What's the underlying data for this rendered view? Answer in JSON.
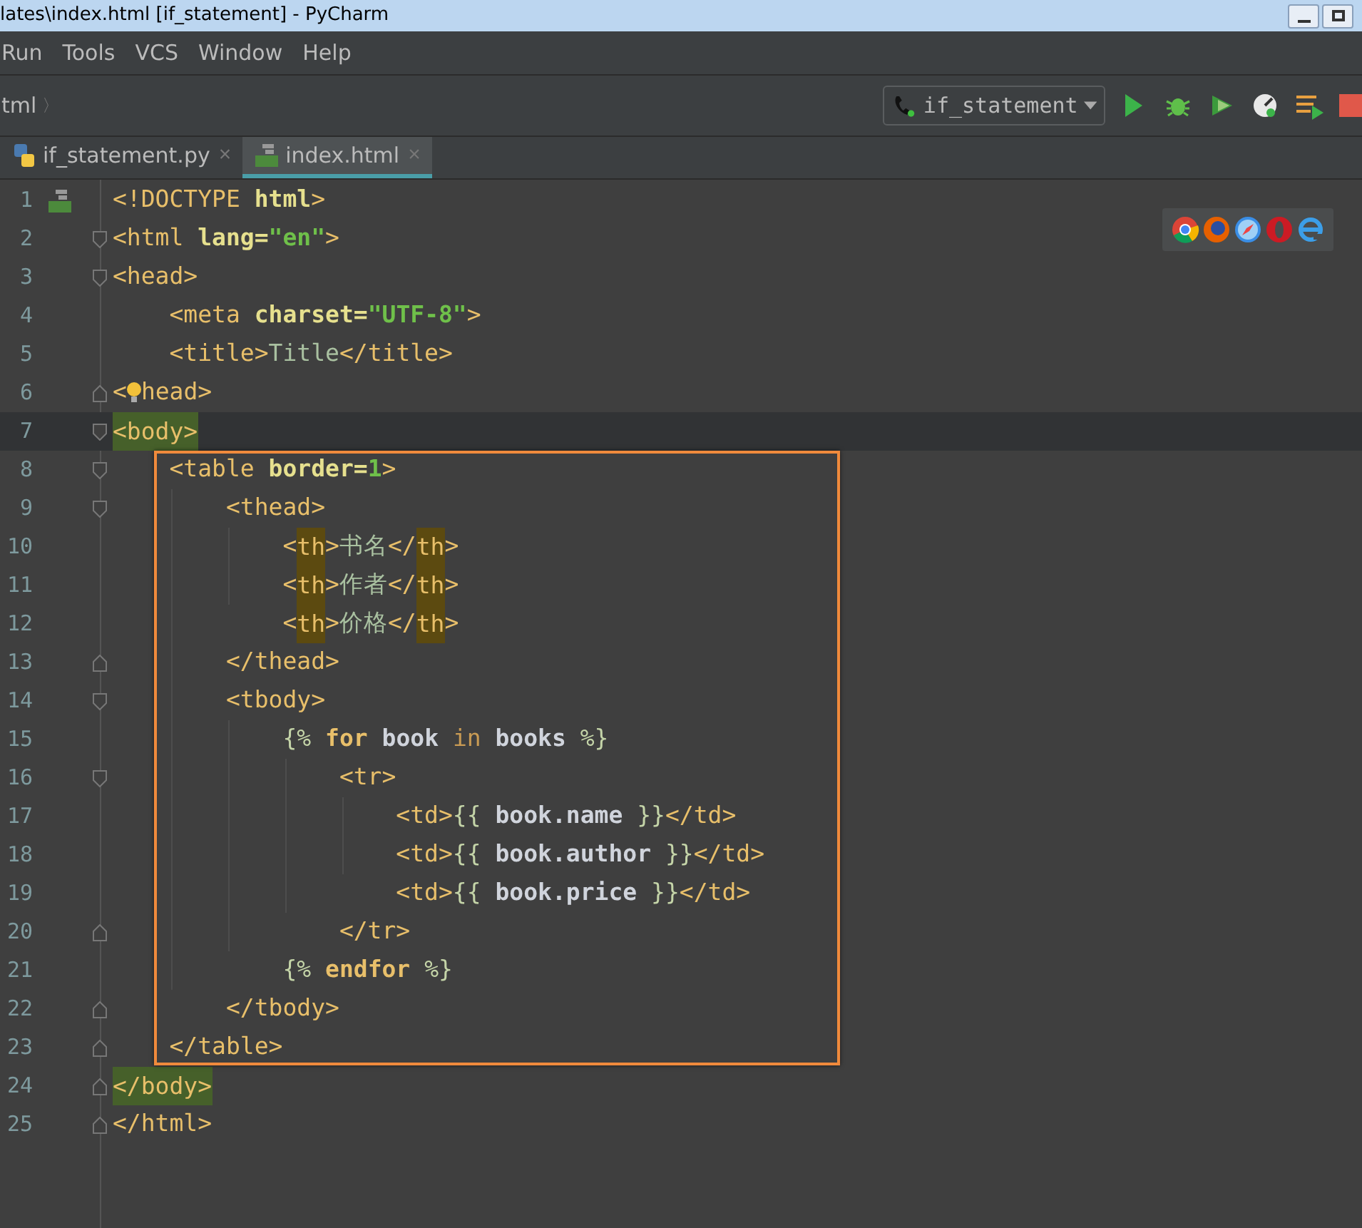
{
  "window": {
    "title": "lates\\index.html [if_statement] - PyCharm"
  },
  "menu": [
    "Run",
    "Tools",
    "VCS",
    "Window",
    "Help"
  ],
  "breadcrumb": {
    "label": "tml",
    "separator": "〉"
  },
  "run_config": {
    "label": "if_statement"
  },
  "tabs": [
    {
      "label": "if_statement.py",
      "kind": "python",
      "selected": false,
      "close": "×"
    },
    {
      "label": "index.html",
      "kind": "html",
      "selected": true,
      "close": "×"
    }
  ],
  "lines": [
    {
      "number": "1",
      "file_marker": true,
      "tokens": [
        {
          "kind": "tag",
          "t": "<!DOCTYPE "
        },
        {
          "kind": "attr",
          "t": "html"
        },
        {
          "kind": "tag",
          "t": ">"
        }
      ]
    },
    {
      "number": "2",
      "fold_start": true,
      "tokens": [
        {
          "kind": "tag",
          "t": "<html "
        },
        {
          "kind": "attr",
          "t": "lang="
        },
        {
          "kind": "str",
          "t": "\"en\""
        },
        {
          "kind": "tag",
          "t": ">"
        }
      ]
    },
    {
      "number": "3",
      "fold_start": true,
      "tokens": [
        {
          "kind": "tag",
          "t": "<head>"
        }
      ]
    },
    {
      "number": "4",
      "tokens": [
        {
          "kind": "tag",
          "t": "    <meta "
        },
        {
          "kind": "attr",
          "t": "charset="
        },
        {
          "kind": "str",
          "t": "\"UTF-8\""
        },
        {
          "kind": "tag",
          "t": ">"
        }
      ]
    },
    {
      "number": "5",
      "tokens": [
        {
          "kind": "tag",
          "t": "    <title>"
        },
        {
          "kind": "text",
          "t": "Title"
        },
        {
          "kind": "tag",
          "t": "</title>"
        }
      ]
    },
    {
      "number": "6",
      "fold_end": true,
      "tokens": [
        {
          "kind": "tag",
          "t": "<"
        },
        {
          "kind": "bulb"
        },
        {
          "kind": "tag",
          "t": "head>"
        }
      ]
    },
    {
      "number": "7",
      "fold_start": true,
      "current": true,
      "tokens": [
        {
          "kind": "tag",
          "t": "<body>",
          "paired": true
        }
      ]
    },
    {
      "number": "8",
      "fold_start": true,
      "tokens": [
        {
          "kind": "tag",
          "t": "    <table "
        },
        {
          "kind": "attr",
          "t": "border="
        },
        {
          "kind": "num",
          "t": "1"
        },
        {
          "kind": "tag",
          "t": ">"
        }
      ]
    },
    {
      "number": "9",
      "fold_start": true,
      "tokens": [
        {
          "kind": "tag",
          "t": "        <thead>"
        }
      ]
    },
    {
      "number": "10",
      "tokens": [
        {
          "kind": "tag",
          "t": "            <"
        },
        {
          "kind": "tag",
          "t": "th",
          "matched": true
        },
        {
          "kind": "tag",
          "t": ">"
        },
        {
          "kind": "text",
          "t": "书名"
        },
        {
          "kind": "tag",
          "t": "</"
        },
        {
          "kind": "tag",
          "t": "th",
          "matched": true
        },
        {
          "kind": "tag",
          "t": ">"
        }
      ]
    },
    {
      "number": "11",
      "tokens": [
        {
          "kind": "tag",
          "t": "            <"
        },
        {
          "kind": "tag",
          "t": "th",
          "matched": true
        },
        {
          "kind": "tag",
          "t": ">"
        },
        {
          "kind": "text",
          "t": "作者"
        },
        {
          "kind": "tag",
          "t": "</"
        },
        {
          "kind": "tag",
          "t": "th",
          "matched": true
        },
        {
          "kind": "tag",
          "t": ">"
        }
      ]
    },
    {
      "number": "12",
      "tokens": [
        {
          "kind": "tag",
          "t": "            <"
        },
        {
          "kind": "tag",
          "t": "th",
          "matched": true
        },
        {
          "kind": "tag",
          "t": ">"
        },
        {
          "kind": "text",
          "t": "价格"
        },
        {
          "kind": "tag",
          "t": "</"
        },
        {
          "kind": "tag",
          "t": "th",
          "matched": true
        },
        {
          "kind": "tag",
          "t": ">"
        }
      ]
    },
    {
      "number": "13",
      "fold_end": true,
      "tokens": [
        {
          "kind": "tag",
          "t": "        </thead>"
        }
      ]
    },
    {
      "number": "14",
      "fold_start": true,
      "tokens": [
        {
          "kind": "tag",
          "t": "        <tbody>"
        }
      ]
    },
    {
      "number": "15",
      "tokens": [
        {
          "kind": "tpl",
          "t": "            {% "
        },
        {
          "kind": "kw",
          "t": "for "
        },
        {
          "kind": "var",
          "t": "book "
        },
        {
          "kind": "op",
          "t": "in "
        },
        {
          "kind": "var",
          "t": "books "
        },
        {
          "kind": "tpl",
          "t": "%}"
        }
      ]
    },
    {
      "number": "16",
      "fold_start": true,
      "tokens": [
        {
          "kind": "tag",
          "t": "                <tr>"
        }
      ]
    },
    {
      "number": "17",
      "tokens": [
        {
          "kind": "tag",
          "t": "                    <td>"
        },
        {
          "kind": "tpl",
          "t": "{{ "
        },
        {
          "kind": "var",
          "t": "book.name "
        },
        {
          "kind": "tpl",
          "t": "}}"
        },
        {
          "kind": "tag",
          "t": "</td>"
        }
      ]
    },
    {
      "number": "18",
      "tokens": [
        {
          "kind": "tag",
          "t": "                    <td>"
        },
        {
          "kind": "tpl",
          "t": "{{ "
        },
        {
          "kind": "var",
          "t": "book.author "
        },
        {
          "kind": "tpl",
          "t": "}}"
        },
        {
          "kind": "tag",
          "t": "</td>"
        }
      ]
    },
    {
      "number": "19",
      "tokens": [
        {
          "kind": "tag",
          "t": "                    <td>"
        },
        {
          "kind": "tpl",
          "t": "{{ "
        },
        {
          "kind": "var",
          "t": "book.price "
        },
        {
          "kind": "tpl",
          "t": "}}"
        },
        {
          "kind": "tag",
          "t": "</td>"
        }
      ]
    },
    {
      "number": "20",
      "fold_end": true,
      "tokens": [
        {
          "kind": "tag",
          "t": "                </tr>"
        }
      ]
    },
    {
      "number": "21",
      "tokens": [
        {
          "kind": "tpl",
          "t": "            {% "
        },
        {
          "kind": "kw",
          "t": "endfor "
        },
        {
          "kind": "tpl",
          "t": "%}"
        }
      ]
    },
    {
      "number": "22",
      "fold_end": true,
      "tokens": [
        {
          "kind": "tag",
          "t": "        </tbody>"
        }
      ]
    },
    {
      "number": "23",
      "fold_end": true,
      "tokens": [
        {
          "kind": "tag",
          "t": "    </table>"
        }
      ]
    },
    {
      "number": "24",
      "fold_end": true,
      "tokens": [
        {
          "kind": "tag",
          "t": "</body>",
          "paired": true
        }
      ]
    },
    {
      "number": "25",
      "fold_end": true,
      "tokens": [
        {
          "kind": "tag",
          "t": "</html>"
        }
      ]
    }
  ]
}
